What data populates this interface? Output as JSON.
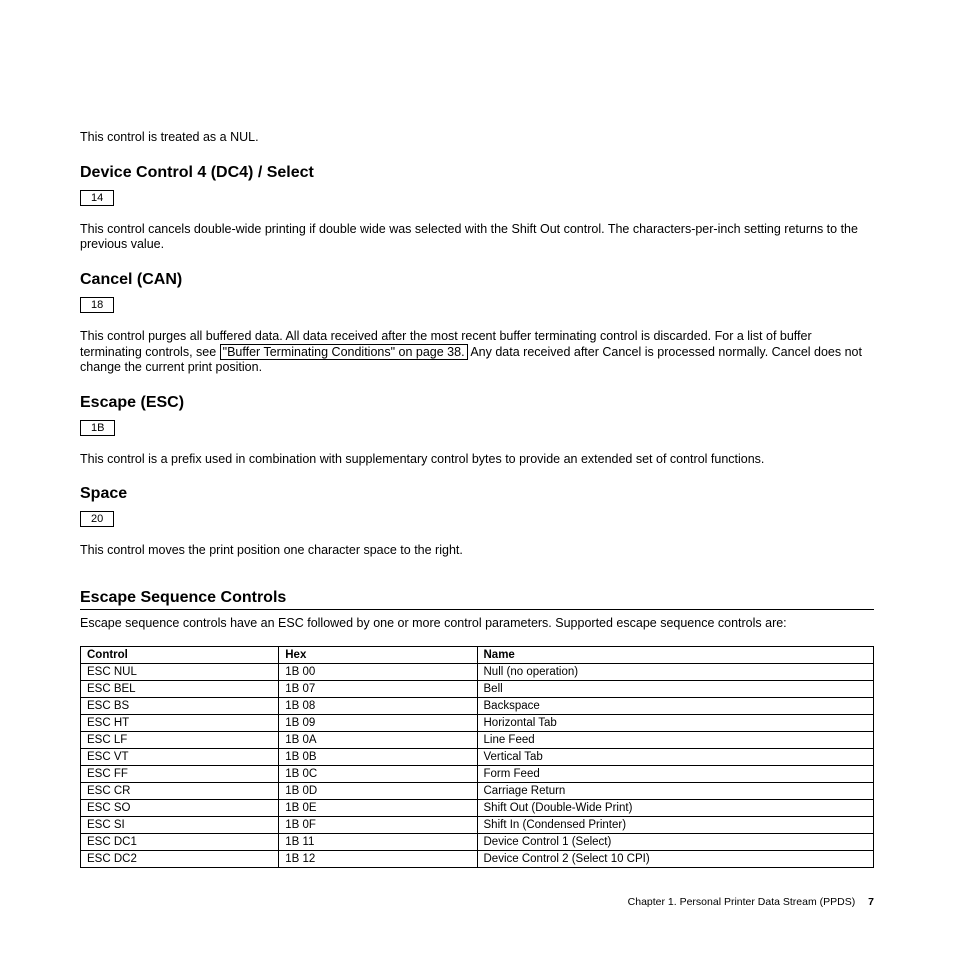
{
  "intro_text": "This control is treated as a NUL.",
  "sections": {
    "dc4": {
      "title": "Device Control 4 (DC4) / Select",
      "hex": "14",
      "body": "This control cancels double-wide printing if double wide was selected with the Shift Out control. The characters-per-inch setting returns to the previous value."
    },
    "can": {
      "title": "Cancel (CAN)",
      "hex": "18",
      "body_pre": "This control purges all buffered data. All data received after the most recent buffer terminating control is discarded. For a list of buffer terminating controls, see ",
      "link_text": "\"Buffer Terminating Conditions\" on page 38.",
      "body_post": " Any data received after Cancel is processed normally. Cancel does not change the current print position."
    },
    "esc": {
      "title": "Escape (ESC)",
      "hex": "1B",
      "body": "This control is a prefix used in combination with supplementary control bytes to provide an extended set of control functions."
    },
    "space": {
      "title": "Space",
      "hex": "20",
      "body": "This control moves the print position one character space to the right."
    },
    "escseq": {
      "title": "Escape Sequence Controls",
      "body": "Escape sequence controls have an ESC followed by one or more control parameters. Supported escape sequence controls are:"
    }
  },
  "table": {
    "headers": {
      "c0": "Control",
      "c1": "Hex",
      "c2": "Name"
    },
    "rows": [
      {
        "c0": "ESC NUL",
        "c1": "1B 00",
        "c2": "Null (no operation)"
      },
      {
        "c0": "ESC BEL",
        "c1": "1B 07",
        "c2": "Bell"
      },
      {
        "c0": "ESC BS",
        "c1": "1B 08",
        "c2": "Backspace"
      },
      {
        "c0": "ESC HT",
        "c1": "1B 09",
        "c2": "Horizontal Tab"
      },
      {
        "c0": "ESC LF",
        "c1": "1B 0A",
        "c2": "Line Feed"
      },
      {
        "c0": "ESC VT",
        "c1": "1B 0B",
        "c2": "Vertical Tab"
      },
      {
        "c0": "ESC FF",
        "c1": "1B 0C",
        "c2": "Form Feed"
      },
      {
        "c0": "ESC CR",
        "c1": "1B 0D",
        "c2": "Carriage Return"
      },
      {
        "c0": "ESC SO",
        "c1": "1B 0E",
        "c2": "Shift Out (Double-Wide Print)"
      },
      {
        "c0": "ESC SI",
        "c1": "1B 0F",
        "c2": "Shift In (Condensed Printer)"
      },
      {
        "c0": "ESC DC1",
        "c1": "1B 11",
        "c2": "Device Control 1 (Select)"
      },
      {
        "c0": "ESC DC2",
        "c1": "1B 12",
        "c2": "Device Control 2 (Select 10 CPI)"
      }
    ]
  },
  "footer": {
    "chapter": "Chapter 1. Personal Printer Data Stream (PPDS)",
    "page": "7"
  }
}
